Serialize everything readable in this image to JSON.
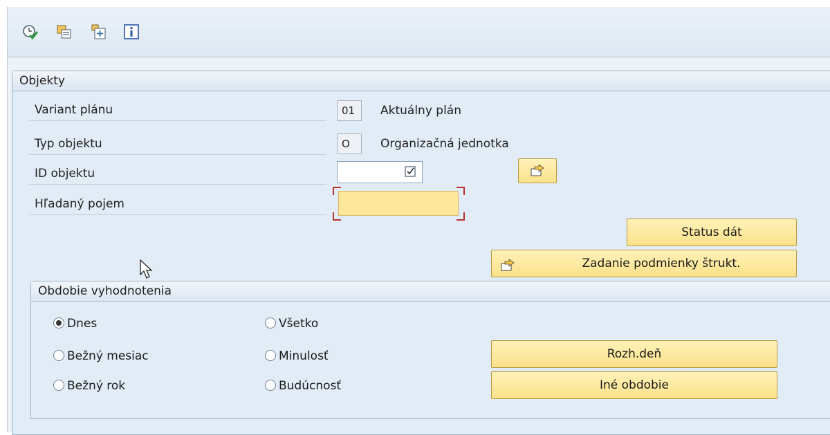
{
  "toolbar": {
    "icons": [
      "execute-clock-icon",
      "copy-icon",
      "new-entry-icon",
      "info-icon"
    ]
  },
  "objects": {
    "title": "Objekty",
    "plan_variant": {
      "label": "Variant plánu",
      "code": "01",
      "text": "Aktuálny plán"
    },
    "object_type": {
      "label": "Typ objektu",
      "code": "O",
      "text": "Organizačná jednotka"
    },
    "object_id": {
      "label": "ID objektu",
      "value": ""
    },
    "search_term": {
      "label": "Hľadaný pojem",
      "value": ""
    },
    "status_button": "Status dát",
    "structure_button": "Zadanie podmienky štrukt."
  },
  "period": {
    "title": "Obdobie vyhodnotenia",
    "options": [
      {
        "label": "Dnes",
        "selected": true
      },
      {
        "label": "Všetko",
        "selected": false
      },
      {
        "label": "Bežný mesiac",
        "selected": false
      },
      {
        "label": "Minulosť",
        "selected": false
      },
      {
        "label": "Bežný rok",
        "selected": false
      },
      {
        "label": "Budúcnosť",
        "selected": false
      }
    ],
    "key_date_button": "Rozh.deň",
    "other_period_button": "Iné obdobie"
  }
}
